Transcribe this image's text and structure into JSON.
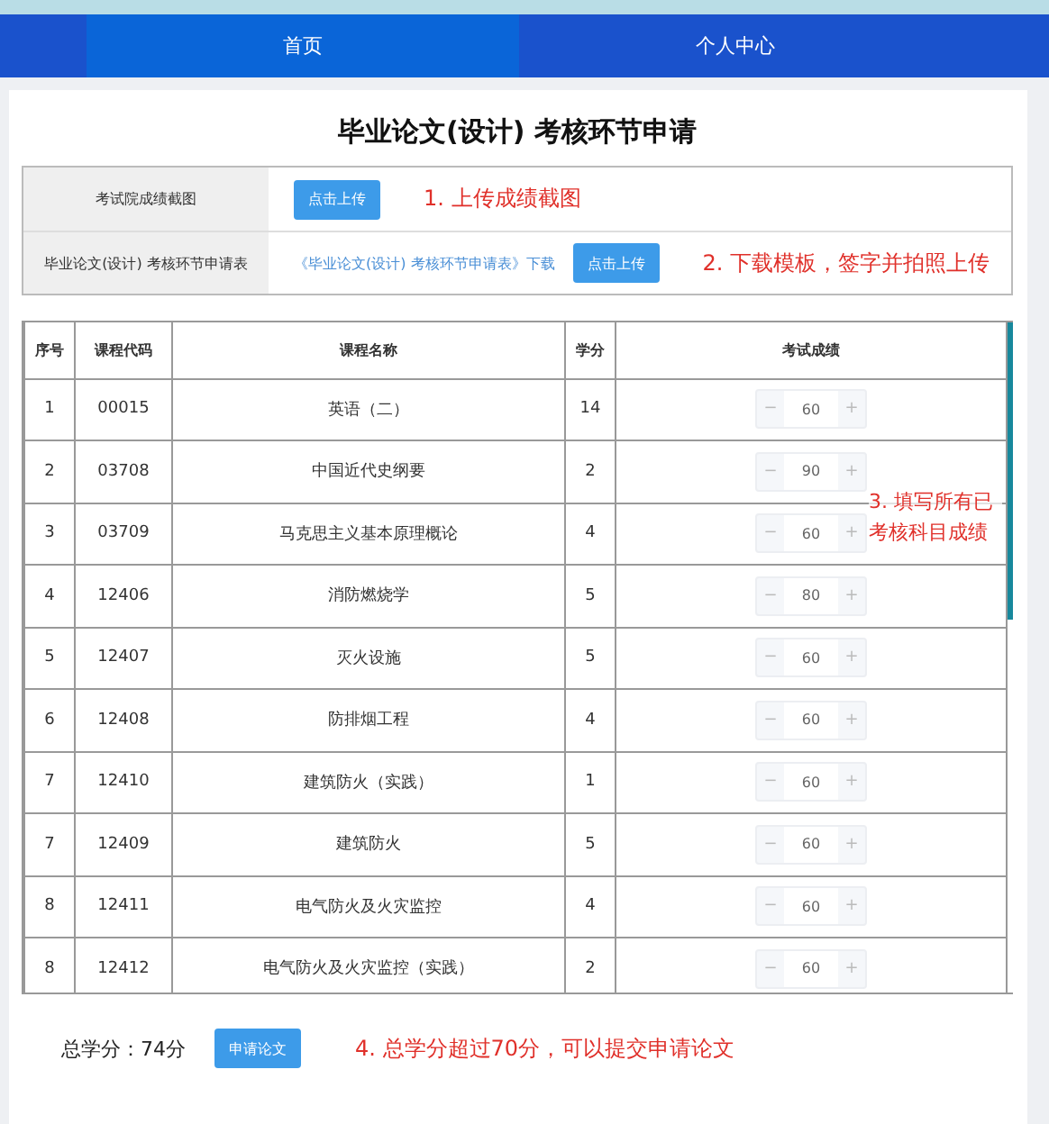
{
  "nav": {
    "tabs": [
      {
        "label": "首页",
        "selected": true
      },
      {
        "label": "个人中心",
        "selected": false
      }
    ]
  },
  "title": "毕业论文(设计) 考核环节申请",
  "upload_rows": [
    {
      "label": "考试院成绩截图",
      "button": "点击上传",
      "note": "1. 上传成绩截图"
    },
    {
      "label": "毕业论文(设计) 考核环节申请表",
      "link": "《毕业论文(设计) 考核环节申请表》下载",
      "button": "点击上传",
      "note": "2. 下载模板，签字并拍照上传"
    }
  ],
  "table": {
    "columns": [
      "序号",
      "课程代码",
      "课程名称",
      "学分",
      "考试成绩"
    ],
    "rows": [
      {
        "no": "1",
        "code": "00015",
        "name": "英语（二）",
        "credit": "14",
        "score": "60"
      },
      {
        "no": "2",
        "code": "03708",
        "name": "中国近代史纲要",
        "credit": "2",
        "score": "90"
      },
      {
        "no": "3",
        "code": "03709",
        "name": "马克思主义基本原理概论",
        "credit": "4",
        "score": "60"
      },
      {
        "no": "4",
        "code": "12406",
        "name": "消防燃烧学",
        "credit": "5",
        "score": "80"
      },
      {
        "no": "5",
        "code": "12407",
        "name": "灭火设施",
        "credit": "5",
        "score": "60"
      },
      {
        "no": "6",
        "code": "12408",
        "name": "防排烟工程",
        "credit": "4",
        "score": "60"
      },
      {
        "no": "7",
        "code": "12410",
        "name": "建筑防火（实践）",
        "credit": "1",
        "score": "60"
      },
      {
        "no": "7",
        "code": "12409",
        "name": "建筑防火",
        "credit": "5",
        "score": "60"
      },
      {
        "no": "8",
        "code": "12411",
        "name": "电气防火及火灾监控",
        "credit": "4",
        "score": "60"
      },
      {
        "no": "8",
        "code": "12412",
        "name": "电气防火及火灾监控（实践）",
        "credit": "2",
        "score": "60"
      }
    ],
    "minus": "−",
    "plus": "+",
    "note": "3. 填写所有已考核科目成绩"
  },
  "footer": {
    "total": "总学分：74分",
    "button": "申请论文",
    "note": "4. 总学分超过70分，可以提交申请论文"
  }
}
